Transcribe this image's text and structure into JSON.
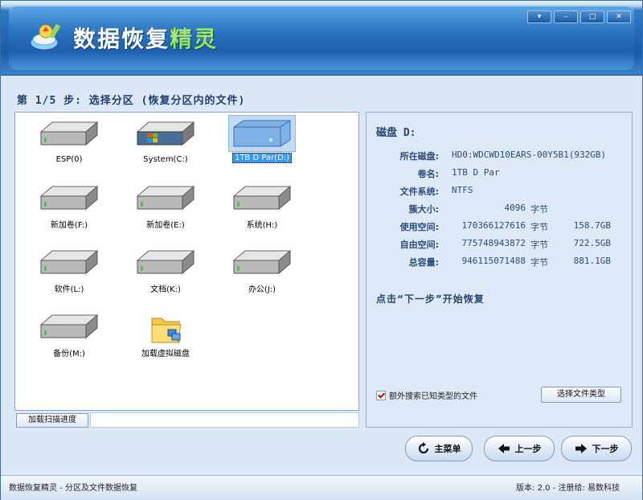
{
  "app": {
    "title_part1": "数据恢复",
    "title_part2": "精灵",
    "window_buttons": [
      "▾",
      "–",
      "□",
      "✕"
    ]
  },
  "step_title": "第 1/5 步: 选择分区 (恢复分区内的文件)",
  "partitions": [
    {
      "label": "ESP(0)",
      "icon": "hard-drive-icon",
      "selected": false
    },
    {
      "label": "System(C:)",
      "icon": "windows-drive-icon",
      "selected": false
    },
    {
      "label": "1TB D Par(D:)",
      "icon": "external-drive-icon",
      "selected": true
    },
    {
      "label": "新加卷(F:)",
      "icon": "hard-drive-icon",
      "selected": false
    },
    {
      "label": "新加卷(E:)",
      "icon": "hard-drive-icon",
      "selected": false
    },
    {
      "label": "系统(H:)",
      "icon": "hard-drive-icon",
      "selected": false
    },
    {
      "label": "软件(L:)",
      "icon": "hard-drive-icon",
      "selected": false
    },
    {
      "label": "文档(K:)",
      "icon": "hard-drive-icon",
      "selected": false
    },
    {
      "label": "办公(J:)",
      "icon": "hard-drive-icon",
      "selected": false
    },
    {
      "label": "备份(M:)",
      "icon": "hard-drive-icon",
      "selected": false
    },
    {
      "label": "加载虚拟磁盘",
      "icon": "folder-virtual-disk-icon",
      "selected": false
    }
  ],
  "scan_progress_button": "加载扫描进度",
  "details": {
    "disk_title": "磁盘 D:",
    "rows": [
      {
        "key": "所在磁盘:",
        "value": "HD0:WDCWD10EARS-00Y5B1(932GB)"
      },
      {
        "key": "卷名:",
        "value": "1TB D Par"
      },
      {
        "key": "文件系统:",
        "value": "NTFS"
      }
    ],
    "cluster": {
      "key": "簇大小:",
      "bytes": "4096",
      "unit": "字节"
    },
    "space": [
      {
        "key": "使用空间:",
        "bytes": "170366127616",
        "unit": "字节",
        "size": "158.7GB"
      },
      {
        "key": "自由空间:",
        "bytes": "775748943872",
        "unit": "字节",
        "size": "722.5GB"
      },
      {
        "key": "总容量:",
        "bytes": "946115071488",
        "unit": "字节",
        "size": "881.1GB"
      }
    ],
    "hint": "点击“下一步”开始恢复",
    "extra_search_label": "额外搜索已知类型的文件",
    "extra_search_checked": true,
    "file_type_button": "选择文件类型"
  },
  "nav": {
    "main_menu": "主菜单",
    "prev": "上一步",
    "next": "下一步"
  },
  "status": {
    "left": "数据恢复精灵 - 分区及文件数据恢复",
    "right": "版本: 2.0 - 注册给: 易数科技"
  },
  "colors": {
    "accent": "#2468b5",
    "title_highlight": "#8ee65a",
    "selection": "#3399ff",
    "info_text": "#2b4b7a"
  }
}
